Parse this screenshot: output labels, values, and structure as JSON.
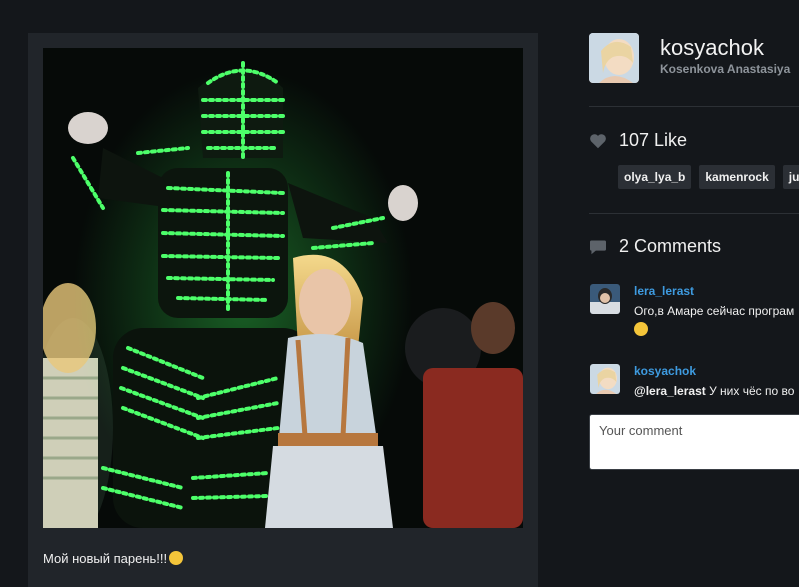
{
  "post": {
    "caption": "Мой новый парень!!!",
    "caption_emoji": "grinning-tongue-emoji"
  },
  "profile": {
    "username": "kosyachok",
    "full_name": "Kosenkova Anastasiya"
  },
  "likes": {
    "count_text": "107 Like",
    "icon": "heart-icon",
    "likers": [
      "olya_lya_b",
      "kamenrock",
      "juli"
    ]
  },
  "comments": {
    "count_text": "2 Comments",
    "icon": "speech-bubble-icon",
    "items": [
      {
        "user": "lera_lerast",
        "text": "Ого,в Амаре сейчас програм",
        "mention": "",
        "has_emoji": true
      },
      {
        "user": "kosyachok",
        "mention": "@lera_lerast",
        "text": " У них чёс по во",
        "has_emoji": false
      }
    ],
    "input_placeholder": "Your comment"
  },
  "colors": {
    "background": "#14171b",
    "card": "#21252a",
    "link": "#3e9be0",
    "led_green": "#4dff6a",
    "tag_bg": "#2b2f35"
  }
}
